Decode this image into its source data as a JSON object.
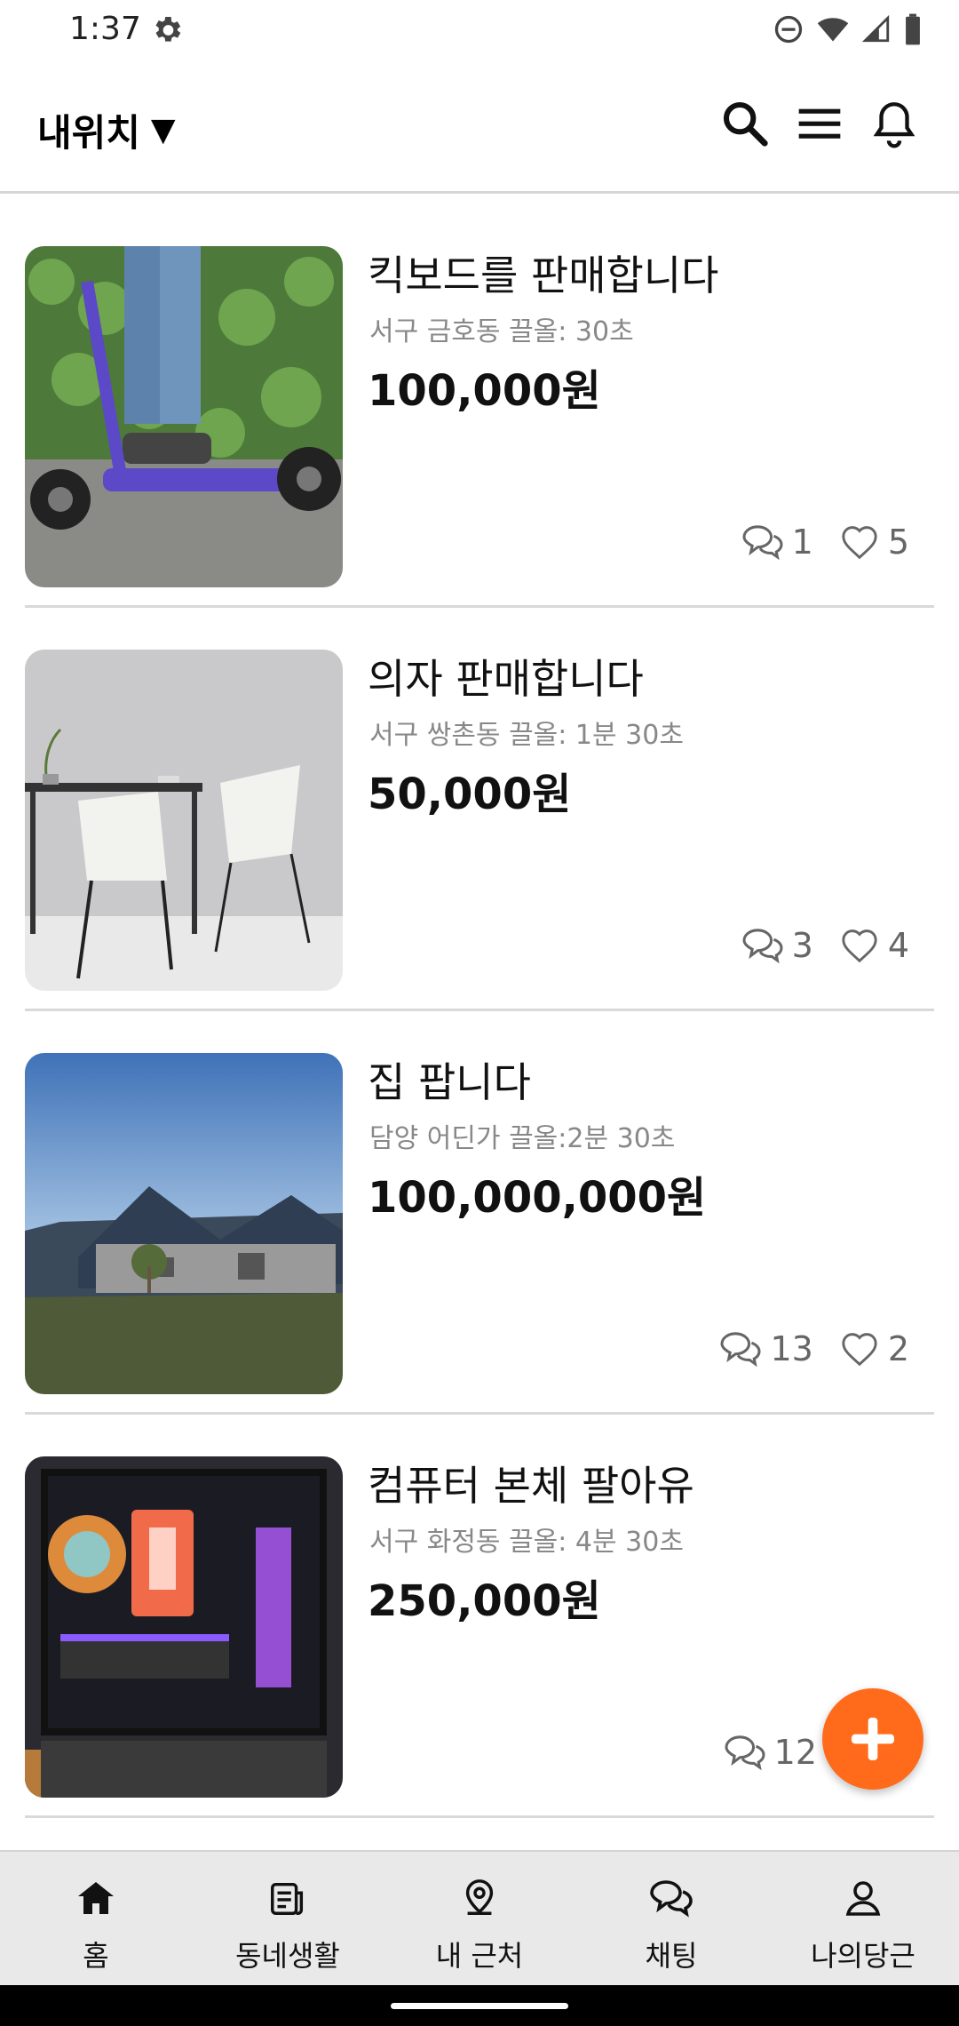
{
  "status_bar": {
    "time": "1:37"
  },
  "header": {
    "location_label": "내위치",
    "caret": "▼",
    "icons": [
      "search-icon",
      "menu-icon",
      "bell-icon"
    ]
  },
  "items": [
    {
      "title": "킥보드를 판매합니다",
      "meta": "서구 금호동 끌올: 30초",
      "price": "100,000원",
      "comments": "1",
      "likes": "5",
      "image": "electric-scooter-photo"
    },
    {
      "title": "의자 판매합니다",
      "meta": "서구 쌍촌동 끌올: 1분 30초",
      "price": "50,000원",
      "comments": "3",
      "likes": "4",
      "image": "white-chairs-photo"
    },
    {
      "title": "집 팝니다",
      "meta": "담양 어딘가 끌올:2분 30초",
      "price": "100,000,000원",
      "comments": "13",
      "likes": "2",
      "image": "house-photo"
    },
    {
      "title": "컴퓨터 본체 팔아유",
      "meta": "서구 화정동 끌올: 4분 30초",
      "price": "250,000원",
      "comments": "12",
      "likes": "",
      "image": "gaming-pc-photo"
    }
  ],
  "fab": {
    "icon": "plus-icon",
    "color": "#ff6b1a"
  },
  "bottom_nav": [
    {
      "label": "홈",
      "icon": "home-icon"
    },
    {
      "label": "동네생활",
      "icon": "community-icon"
    },
    {
      "label": "내 근처",
      "icon": "location-pin-icon"
    },
    {
      "label": "채팅",
      "icon": "chat-icon"
    },
    {
      "label": "나의당근",
      "icon": "profile-icon"
    }
  ]
}
